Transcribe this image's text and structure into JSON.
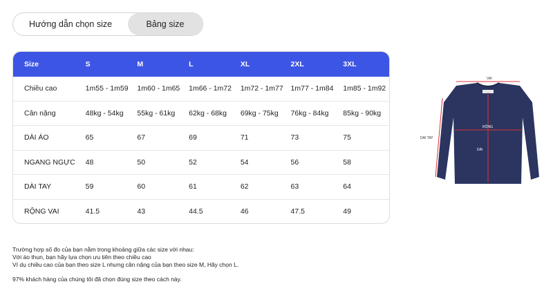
{
  "tabs": {
    "guide": "Hướng dẫn chọn size",
    "table": "Bảng size"
  },
  "size_table": {
    "header": [
      "Size",
      "S",
      "M",
      "L",
      "XL",
      "2XL",
      "3XL"
    ],
    "rows": [
      [
        "Chiều cao",
        "1m55 - 1m59",
        "1m60 - 1m65",
        "1m66 - 1m72",
        "1m72 - 1m77",
        "1m77 - 1m84",
        "1m85 - 1m92"
      ],
      [
        "Cân nặng",
        "48kg - 54kg",
        "55kg - 61kg",
        "62kg - 68kg",
        "69kg - 75kg",
        "76kg - 84kg",
        "85kg - 90kg"
      ],
      [
        "DÀI ÁO",
        "65",
        "67",
        "69",
        "71",
        "73",
        "75"
      ],
      [
        "NGANG NGỰC",
        "48",
        "50",
        "52",
        "54",
        "56",
        "58"
      ],
      [
        "DÀI TAY",
        "59",
        "60",
        "61",
        "62",
        "63",
        "64"
      ],
      [
        "RỘNG VAI",
        "41.5",
        "43",
        "44.5",
        "46",
        "47.5",
        "49"
      ]
    ]
  },
  "notes": {
    "line1": "Trường hợp số đo của bạn nằm trong khoảng giữa các size với nhau:",
    "line2": "Với áo thun, bạn hãy lựa chọn ưu tiên theo chiều cao",
    "line3": "Ví dụ chiều cao của bạn theo size L nhưng cân nặng của bạn theo size M, Hãy chọn L.",
    "line4": "97% khách hàng của chúng tôi đã chọn đúng size theo cách này."
  },
  "diagram": {
    "vai": "VAI",
    "dai_tay": "DÀI TAY",
    "rong": "RỘNG",
    "dai": "DÀI",
    "shirt_color": "#2b3560",
    "measure_color": "#e0303a"
  },
  "colors": {
    "header": "#3d55e4"
  }
}
